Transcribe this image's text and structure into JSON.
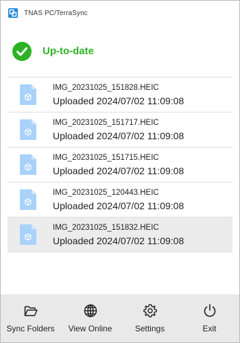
{
  "window": {
    "title": "TNAS PC/TerraSync"
  },
  "status": {
    "text": "Up-to-date",
    "color": "#2db224"
  },
  "files": [
    {
      "name": "IMG_20231025_151828.HEIC",
      "status": "Uploaded 2024/07/02 11:09:08",
      "icon": "heic-file-icon"
    },
    {
      "name": "IMG_20231025_151717.HEIC",
      "status": "Uploaded 2024/07/02 11:09:08",
      "icon": "heic-file-icon"
    },
    {
      "name": "IMG_20231025_151715.HEIC",
      "status": "Uploaded 2024/07/02 11:09:08",
      "icon": "heic-file-icon"
    },
    {
      "name": "IMG_20231025_120443.HEIC",
      "status": "Uploaded 2024/07/02 11:09:08",
      "icon": "heic-file-icon"
    },
    {
      "name": "IMG_20231025_151832.HEIC",
      "status": "Uploaded 2024/07/02 11:09:08",
      "icon": "heic-file-icon"
    }
  ],
  "toolbar": {
    "sync_folders": {
      "label": "Sync Folders",
      "icon": "folder-open-icon"
    },
    "view_online": {
      "label": "View Online",
      "icon": "globe-icon"
    },
    "settings": {
      "label": "Settings",
      "icon": "gear-icon"
    },
    "exit": {
      "label": "Exit",
      "icon": "power-icon"
    }
  }
}
